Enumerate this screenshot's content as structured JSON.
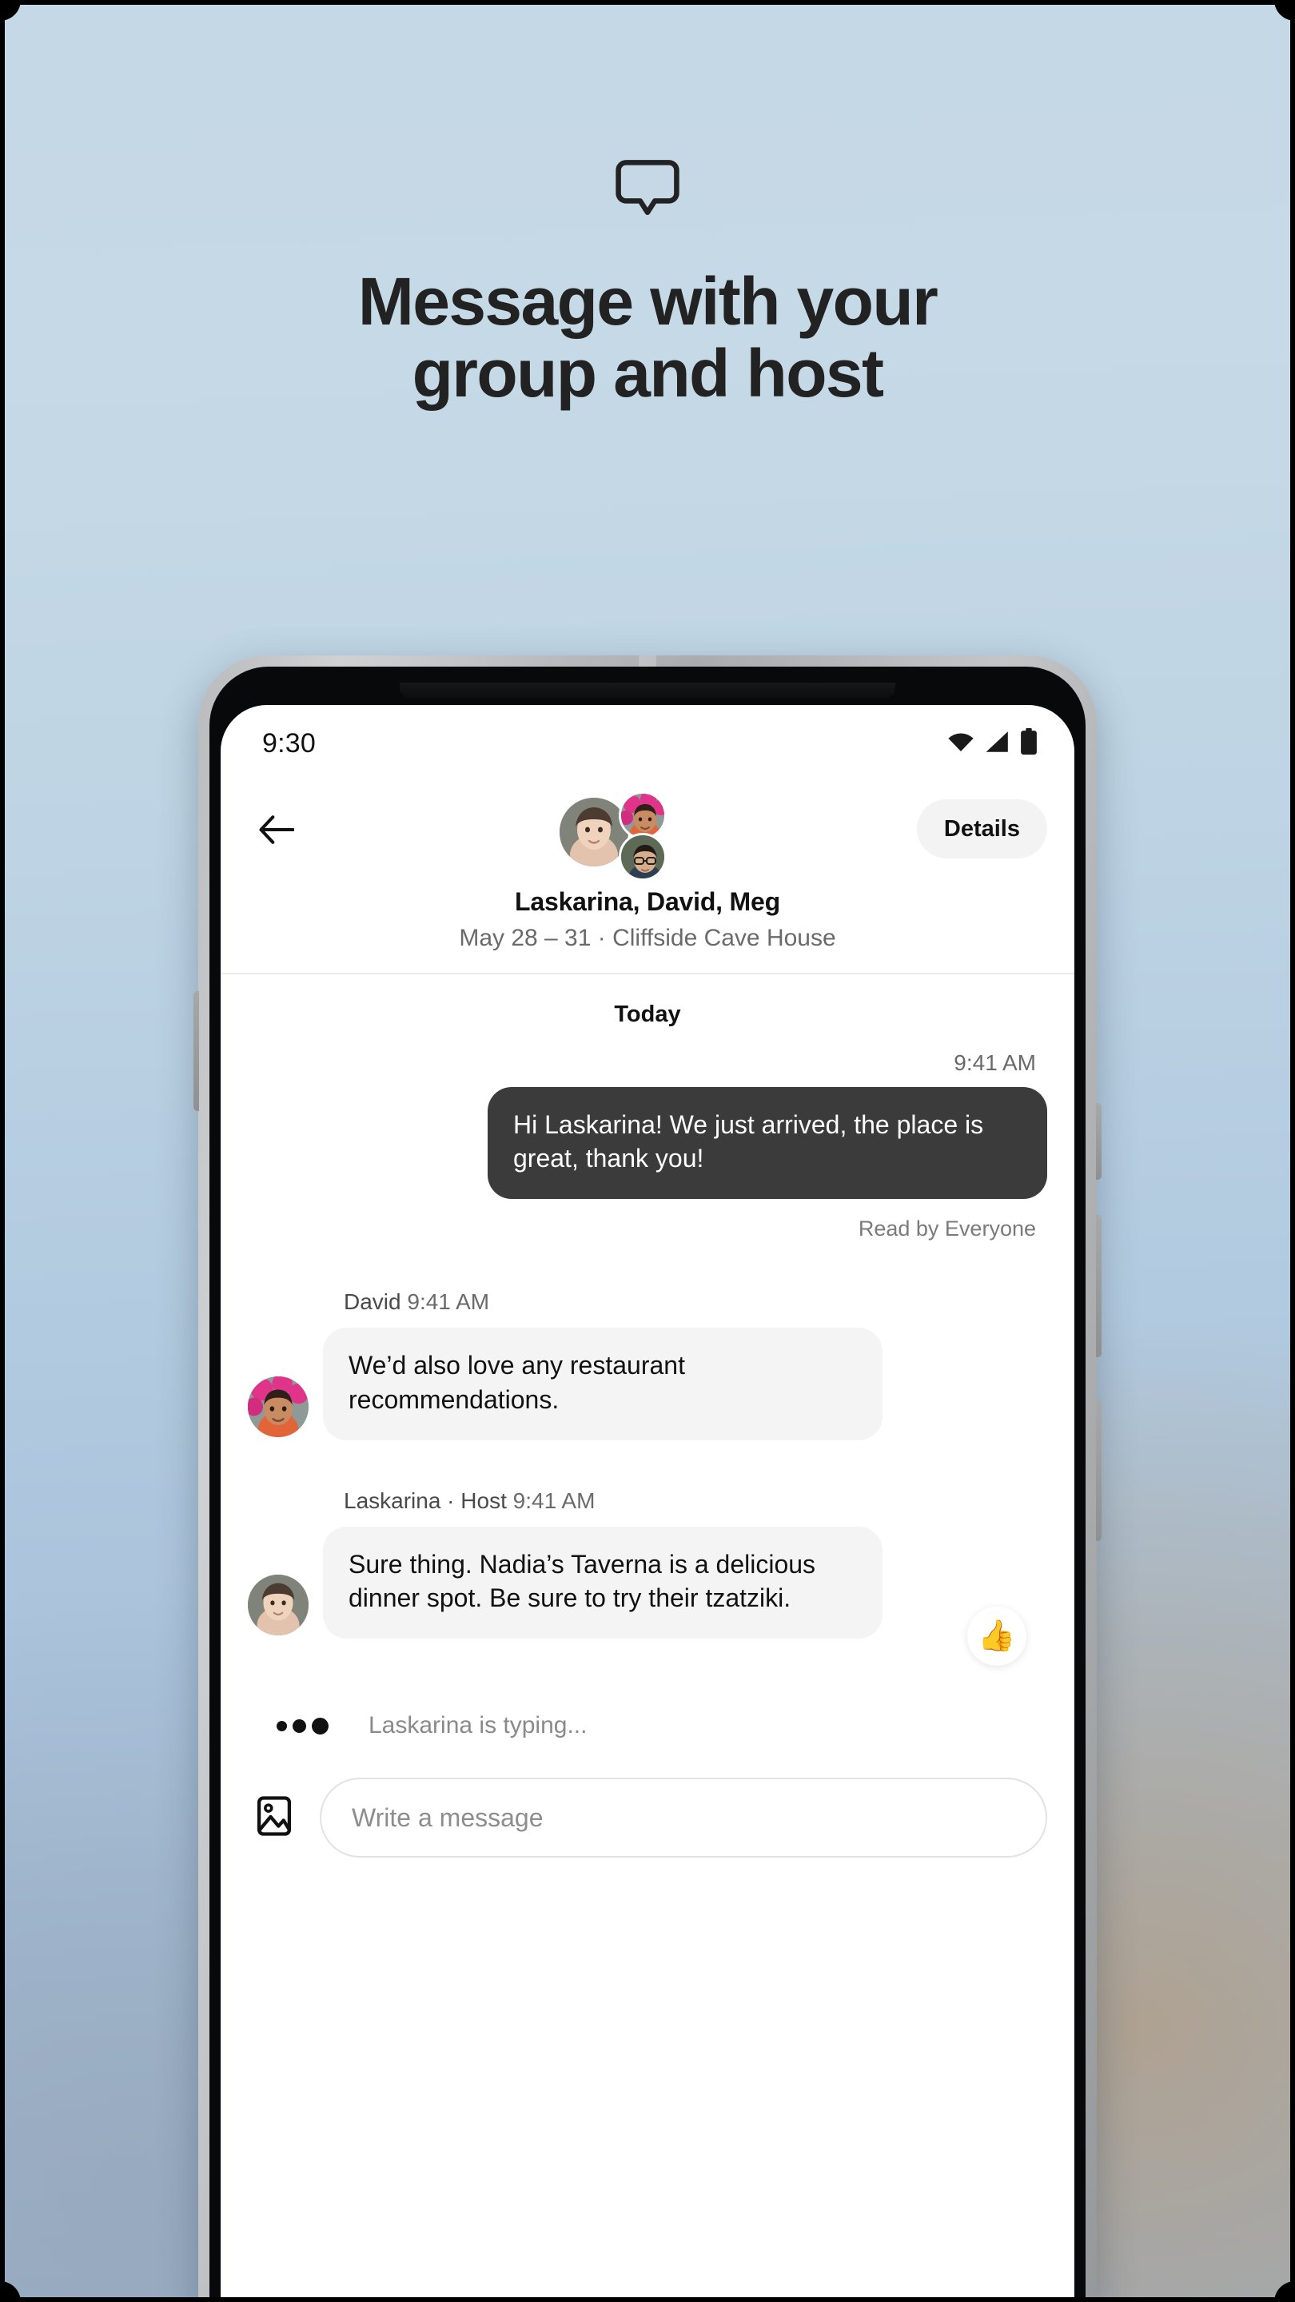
{
  "hero": {
    "icon": "speech-bubble-icon",
    "title_line1": "Message with your",
    "title_line2": "group and host"
  },
  "phone": {
    "statusbar": {
      "time": "9:30",
      "icons": [
        "wifi-icon",
        "cellular-signal-icon",
        "battery-icon"
      ]
    },
    "header": {
      "back_icon": "back-arrow-icon",
      "details_label": "Details",
      "title": "Laskarina, David, Meg",
      "subtitle": "May 28 – 31 · Cliffside Cave House",
      "avatars": [
        "laskarina-avatar",
        "david-avatar",
        "meg-avatar"
      ]
    },
    "thread": {
      "day_divider": "Today",
      "outgoing": {
        "time": "9:41 AM",
        "text": "Hi Laskarina! We just arrived, the place is great, thank you!",
        "receipt": "Read by Everyone"
      },
      "messages": [
        {
          "sender": "David",
          "time": "9:41 AM",
          "text": "We’d also love any restaurant recommendations.",
          "reaction": ""
        },
        {
          "sender": "Laskarina · Host",
          "time": "9:41 AM",
          "text": "Sure thing. Nadia’s Taverna is a delicious dinner spot. Be sure to try their tzatziki.",
          "reaction": "👍"
        }
      ],
      "typing": "Laskarina is typing..."
    },
    "composer": {
      "photo_icon": "image-attachment-icon",
      "placeholder": "Write a message"
    }
  },
  "colors": {
    "outgoing_bubble": "#3c3b3b",
    "incoming_bubble": "#f4f4f4",
    "details_pill": "#f3f3f3",
    "muted_text": "#6a6a6a",
    "bg_top": "#c5d8e6"
  }
}
